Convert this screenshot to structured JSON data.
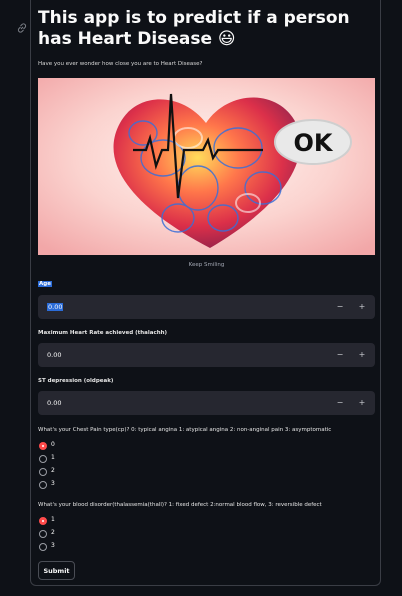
{
  "header": {
    "title": "This app is to predict if a person has Heart Disease 😃",
    "subtitle": "Have you ever wonder how close you are to Heart Disease?"
  },
  "hero": {
    "badge_text": "OK",
    "caption": "Keep Smiling"
  },
  "fields": [
    {
      "label": "Age",
      "value": "0.00"
    },
    {
      "label": "Maximum Heart Rate achieved (thalachh)",
      "value": "0.00"
    },
    {
      "label": "ST depression (oldpeak)",
      "value": "0.00"
    }
  ],
  "stepper": {
    "minus": "−",
    "plus": "+"
  },
  "chest_pain": {
    "question": "What's your Chest Pain type(cp)? 0: typical angina 1: atypical angina 2: non-anginal pain 3: asymptomatic",
    "options": [
      "0",
      "1",
      "2",
      "3"
    ],
    "selected": "0"
  },
  "thal": {
    "question": "What's your blood disorder(thalassemia(thall)? 1: fixed defect 2:normal blood flow, 3: reversible defect",
    "options": [
      "1",
      "2",
      "3"
    ],
    "selected": "1"
  },
  "submit_label": "Submit",
  "colors": {
    "accent": "#ff4b4b",
    "selection": "#2b6cd8",
    "background": "#0e1117",
    "input_bg": "#262730"
  }
}
